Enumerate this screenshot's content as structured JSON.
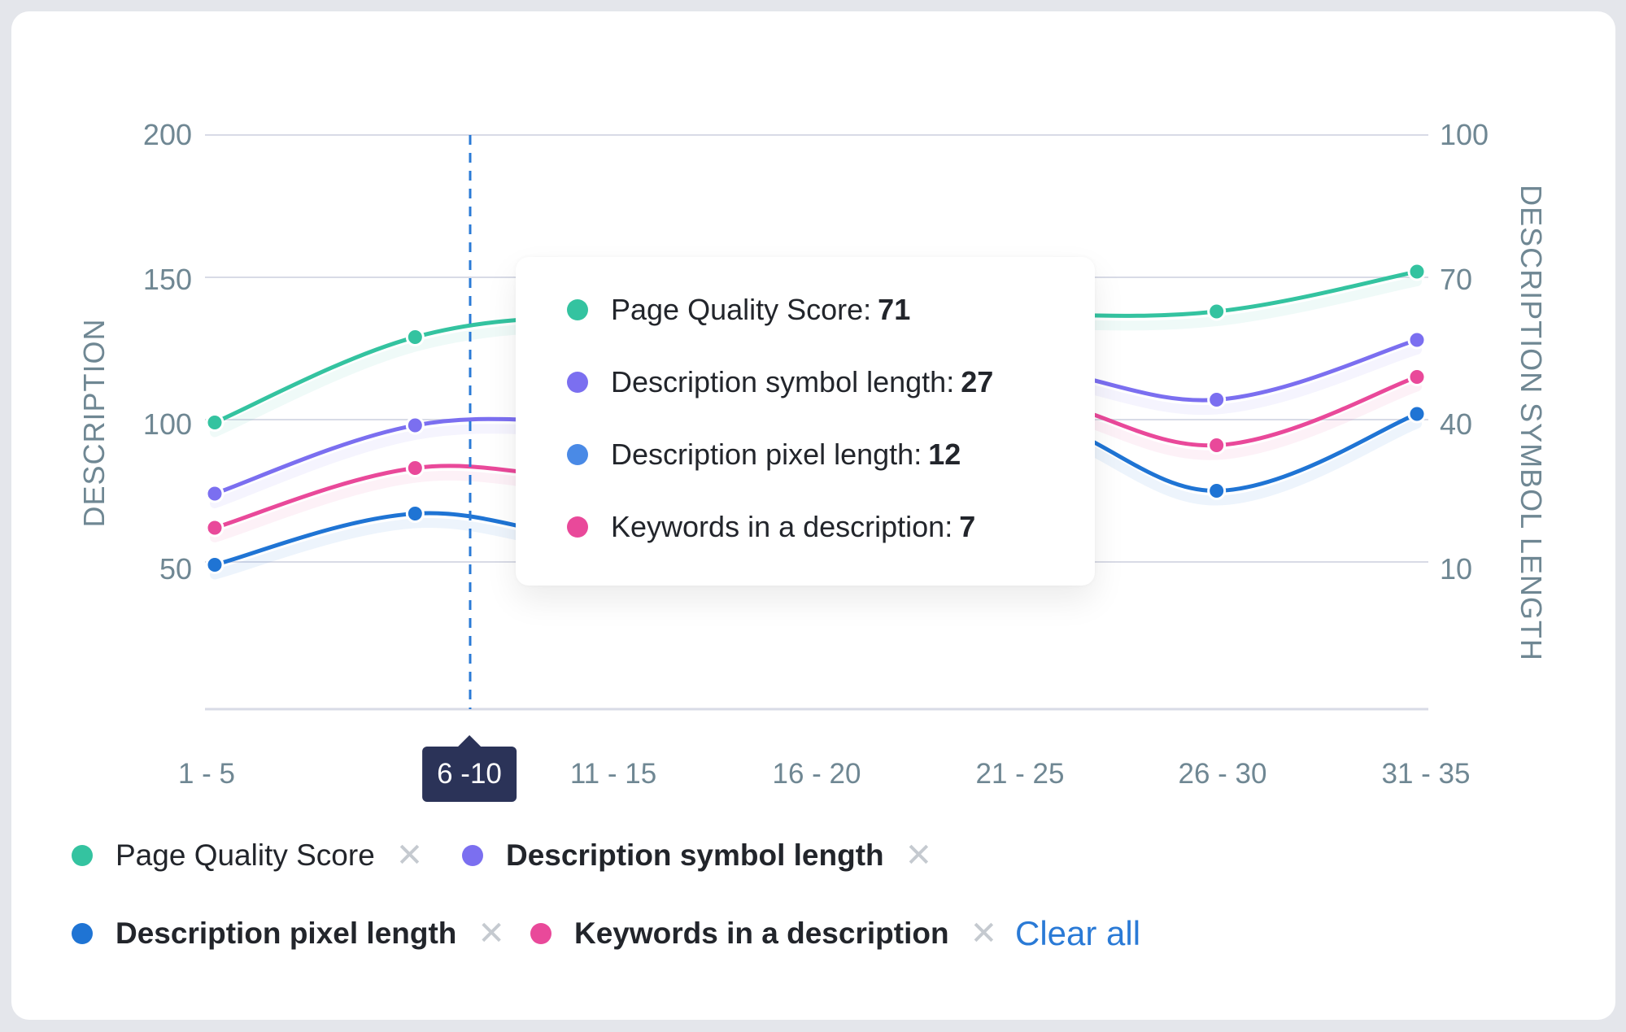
{
  "chart_data": {
    "type": "line",
    "categories": [
      "1 - 5",
      "6 -10",
      "11 - 15",
      "16 - 20",
      "21 - 25",
      "26 - 30",
      "31 - 35"
    ],
    "active_category_index": 1,
    "left_axis": {
      "title": "DESCRIPTION",
      "ticks": [
        "200",
        "150",
        "100",
        "50"
      ],
      "range": [
        0,
        200
      ]
    },
    "right_axis": {
      "title": "DESCRIPTION SYMBOL LENGTH",
      "ticks": [
        "100",
        "70",
        "40",
        "10"
      ],
      "range": [
        -20,
        100
      ]
    },
    "grid": true,
    "series": [
      {
        "name": "Page Quality Score",
        "color": "#34c3a0",
        "values": [
          99,
          129,
          137,
          138,
          137,
          138,
          152
        ]
      },
      {
        "name": "Description symbol length",
        "color": "#7b6ff0",
        "values": [
          74,
          98,
          100,
          108,
          118,
          107,
          128
        ]
      },
      {
        "name": "Description pixel length",
        "color": "#1f74d4",
        "values": [
          49,
          67,
          58,
          70,
          100,
          75,
          102
        ]
      },
      {
        "name": "Keywords in a description",
        "color": "#e9499a",
        "values": [
          62,
          83,
          80,
          95,
          108,
          91,
          115
        ]
      }
    ],
    "tooltip": {
      "rows": [
        {
          "label": "Page Quality Score:",
          "value": "71",
          "color": "#34c3a0"
        },
        {
          "label": "Description symbol length:",
          "value": "27",
          "color": "#7b6ff0"
        },
        {
          "label": "Description pixel length:",
          "value": "12",
          "color": "#4a8ae6"
        },
        {
          "label": "Keywords in a description:",
          "value": "7",
          "color": "#e9499a"
        }
      ]
    }
  },
  "legend": {
    "items": [
      {
        "label": "Page Quality Score",
        "color": "#34c3a0",
        "bold": false
      },
      {
        "label": "Description symbol length",
        "color": "#7b6ff0",
        "bold": true
      },
      {
        "label": "Description pixel length",
        "color": "#1f74d4",
        "bold": true
      },
      {
        "label": "Keywords in a description",
        "color": "#e9499a",
        "bold": true
      }
    ],
    "close_glyph": "✕",
    "clear_all": "Clear all"
  }
}
